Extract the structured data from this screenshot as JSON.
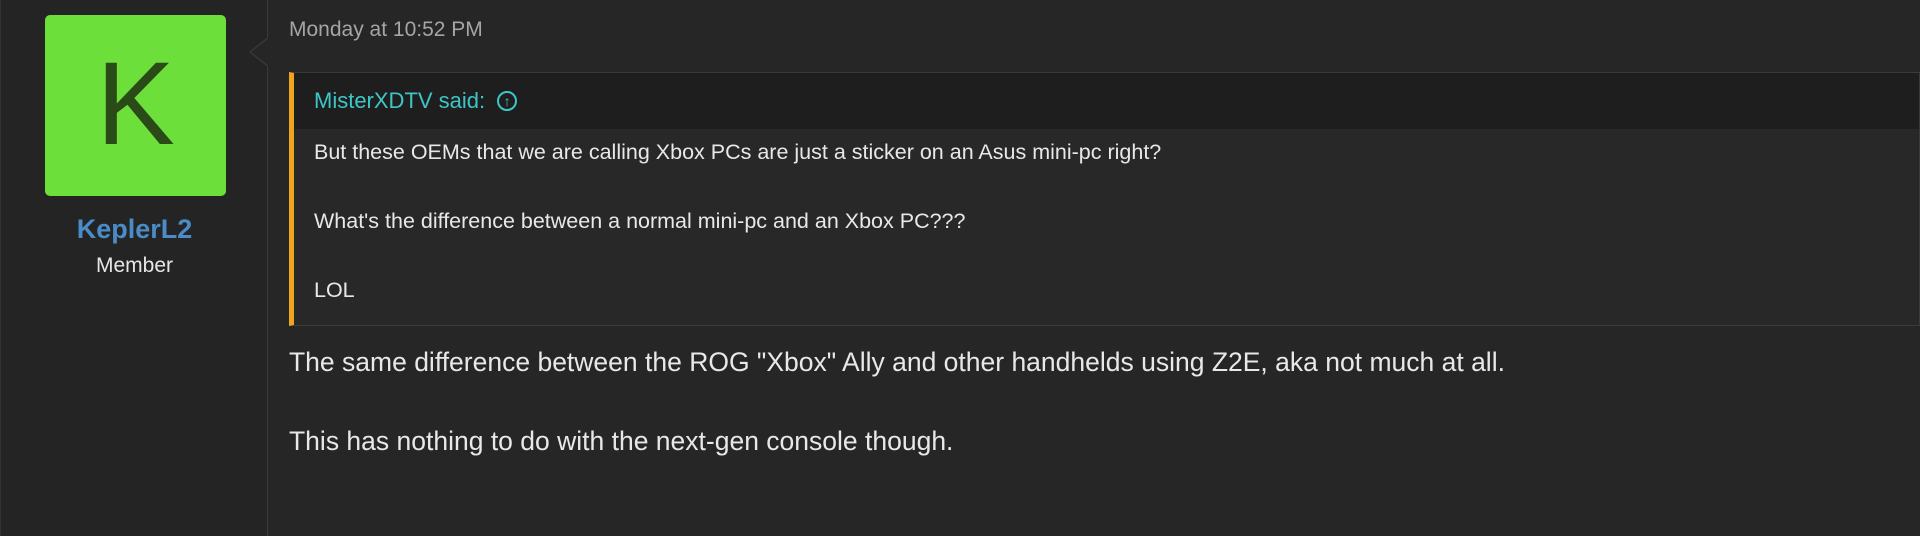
{
  "user": {
    "avatar_letter": "K",
    "avatar_color": "#6ddf3a",
    "name": "KeplerL2",
    "title": "Member",
    "name_color": "#4a8cc7"
  },
  "post": {
    "timestamp": "Monday at 10:52 PM",
    "quote": {
      "author_line": "MisterXDTV said:",
      "jump_icon": "arrow-up-circle-icon",
      "accent_color": "#f0a41e",
      "lines": [
        "But these OEMs that we are calling Xbox PCs are just a sticker on an Asus mini-pc right?",
        "What's the difference between a normal mini-pc and an Xbox PC???",
        "LOL"
      ]
    },
    "body": [
      "The same difference between the ROG \"Xbox\" Ally and other handhelds using Z2E, aka not much at all.",
      "This has nothing to do with the next-gen console though."
    ]
  }
}
